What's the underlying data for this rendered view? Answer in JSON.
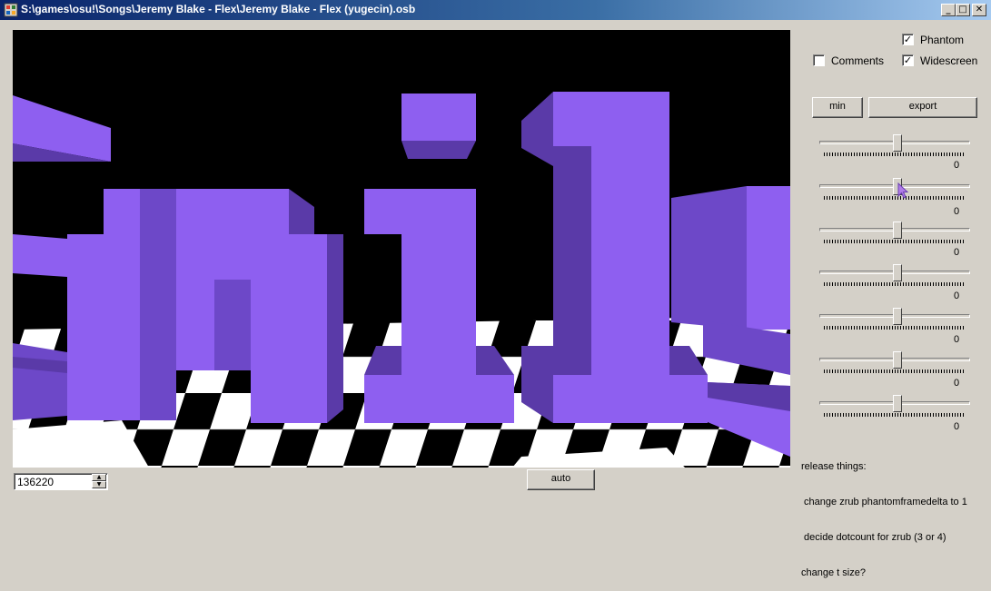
{
  "window": {
    "title": "S:\\games\\osu!\\Songs\\Jeremy Blake - Flex\\Jeremy Blake - Flex (yugecin).osb",
    "min_glyph": "_",
    "max_glyph": "□",
    "close_glyph": "✕"
  },
  "options": {
    "phantom_label": "Phantom",
    "phantom_checked": true,
    "comments_label": "Comments",
    "comments_checked": false,
    "widescreen_label": "Widescreen",
    "widescreen_checked": true
  },
  "buttons": {
    "min_label": "min",
    "export_label": "export",
    "auto_label": "auto"
  },
  "sliders": [
    {
      "value": 0,
      "level": 0.52
    },
    {
      "value": 0,
      "level": 0.52
    },
    {
      "value": 0,
      "level": 0.52
    },
    {
      "value": 0,
      "level": 0.52
    },
    {
      "value": 0,
      "level": 0.52
    },
    {
      "value": 0,
      "level": 0.52
    },
    {
      "value": 0,
      "level": 0.52
    }
  ],
  "notes": {
    "lines": [
      "release things:",
      " change zrub phantomframedelta to 1",
      " decide dotcount for zrub (3 or 4)",
      "change t size?"
    ]
  },
  "time_spinner": {
    "value": "136220"
  },
  "colors": {
    "block_front": "#8e5ff0",
    "block_side": "#5a3aa8",
    "block_top": "#6d48c8",
    "floor_white": "#ffffff",
    "floor_black": "#000000"
  }
}
